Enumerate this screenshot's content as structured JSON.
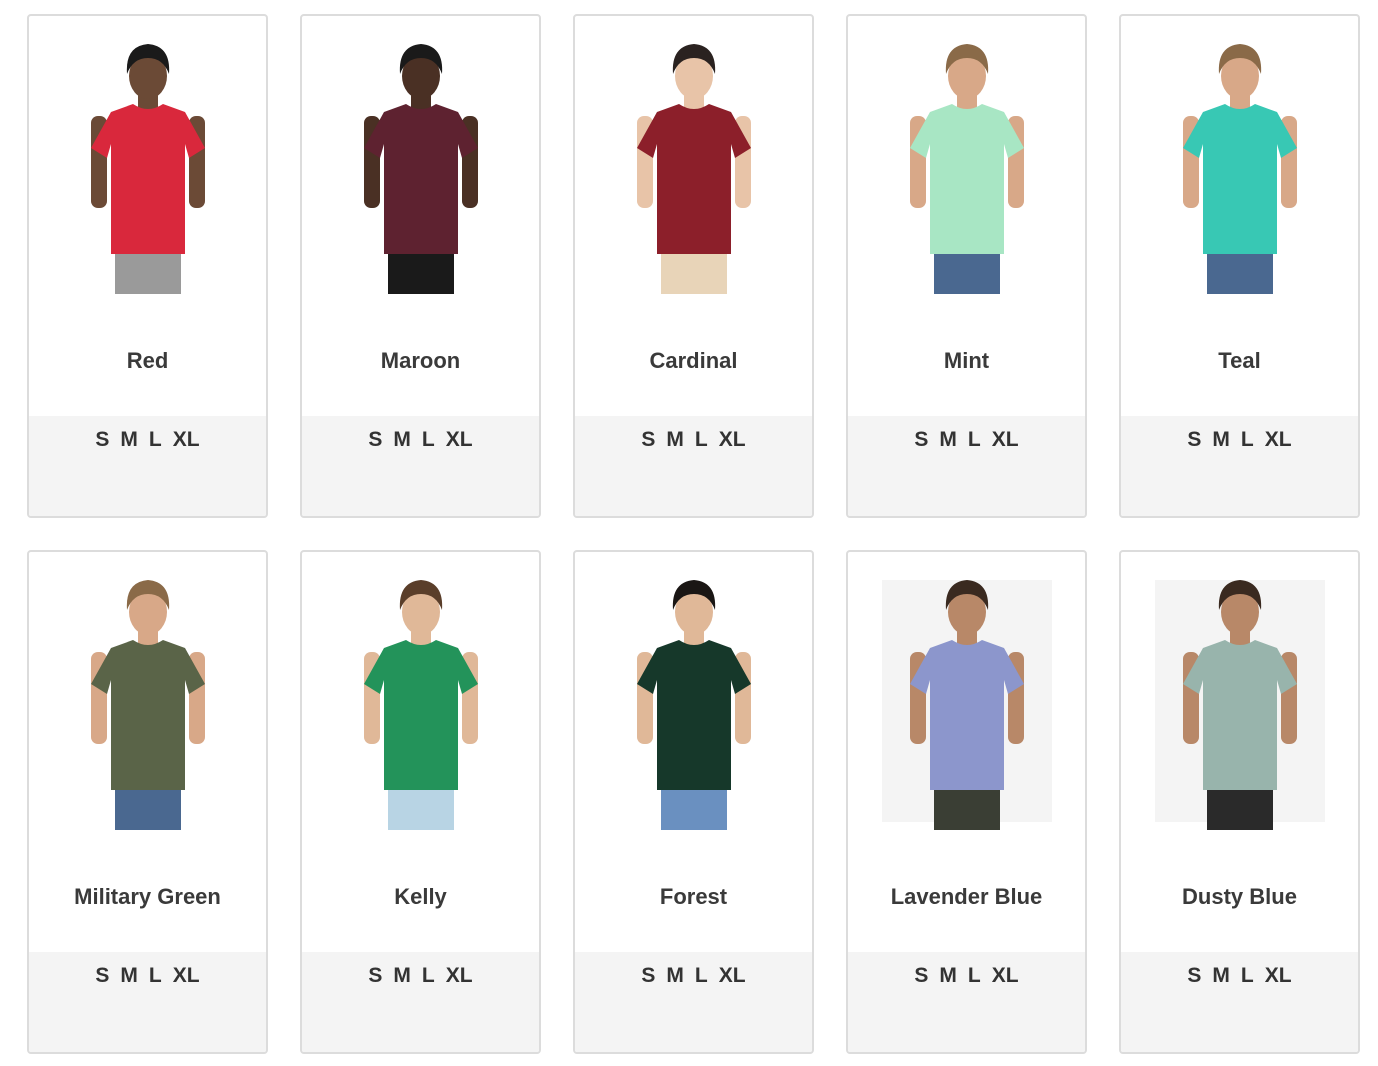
{
  "products": [
    {
      "name": "Red",
      "color": "#d9283c",
      "pants": "#9a9a9a",
      "hair": "#1a1a1a",
      "skin": "#6b4a36",
      "bg": "",
      "sizes": [
        "S",
        "M",
        "L",
        "XL"
      ]
    },
    {
      "name": "Maroon",
      "color": "#5e2230",
      "pants": "#1a1a1a",
      "hair": "#1a1a1a",
      "skin": "#4a3024",
      "bg": "",
      "sizes": [
        "S",
        "M",
        "L",
        "XL"
      ]
    },
    {
      "name": "Cardinal",
      "color": "#8c1f2a",
      "pants": "#e8d4b8",
      "hair": "#2a2220",
      "skin": "#e8c4a8",
      "bg": "",
      "sizes": [
        "S",
        "M",
        "L",
        "XL"
      ]
    },
    {
      "name": "Mint",
      "color": "#a8e6c4",
      "pants": "#4a6890",
      "hair": "#8a6a48",
      "skin": "#d8a888",
      "bg": "",
      "sizes": [
        "S",
        "M",
        "L",
        "XL"
      ]
    },
    {
      "name": "Teal",
      "color": "#38c8b4",
      "pants": "#4a6890",
      "hair": "#8a6a48",
      "skin": "#d8a888",
      "bg": "",
      "sizes": [
        "S",
        "M",
        "L",
        "XL"
      ]
    },
    {
      "name": "Military Green",
      "color": "#5a6448",
      "pants": "#4a6890",
      "hair": "#8a6a48",
      "skin": "#d8a888",
      "bg": "",
      "sizes": [
        "S",
        "M",
        "L",
        "XL"
      ]
    },
    {
      "name": "Kelly",
      "color": "#23935a",
      "pants": "#b8d4e4",
      "hair": "#5a3e2a",
      "skin": "#e0b898",
      "bg": "",
      "sizes": [
        "S",
        "M",
        "L",
        "XL"
      ]
    },
    {
      "name": "Forest",
      "color": "#16382a",
      "pants": "#6a90c0",
      "hair": "#1a1614",
      "skin": "#e0b898",
      "bg": "",
      "sizes": [
        "S",
        "M",
        "L",
        "XL"
      ]
    },
    {
      "name": "Lavender Blue",
      "color": "#8c96cc",
      "pants": "#3a3e34",
      "hair": "#3a2a20",
      "skin": "#b88868",
      "bg": "#f4f4f4",
      "sizes": [
        "S",
        "M",
        "L",
        "XL"
      ]
    },
    {
      "name": "Dusty Blue",
      "color": "#98b4ac",
      "pants": "#2a2a2a",
      "hair": "#3a2a20",
      "skin": "#b88868",
      "bg": "#f4f4f4",
      "sizes": [
        "S",
        "M",
        "L",
        "XL"
      ]
    }
  ]
}
